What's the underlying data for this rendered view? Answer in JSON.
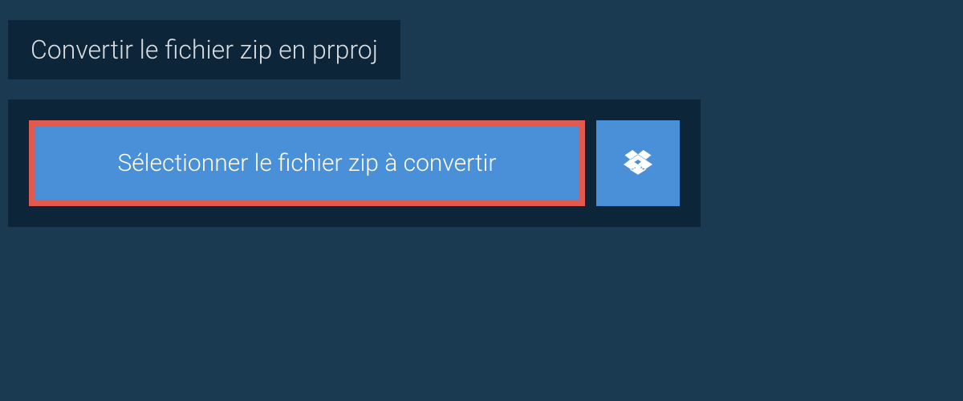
{
  "title": "Convertir le fichier zip en prproj",
  "selectButton": {
    "label": "Sélectionner le fichier zip à convertir"
  }
}
